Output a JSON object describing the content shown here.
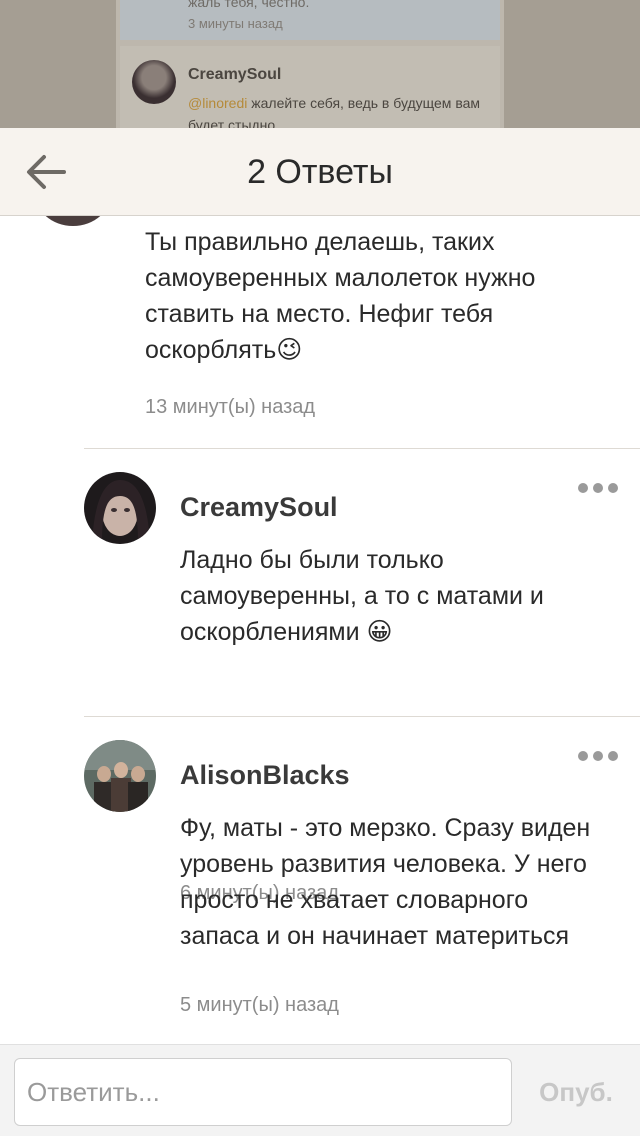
{
  "background": {
    "prev_text": "жаль тебя, честно.",
    "prev_time": "3 минуты назад",
    "comment": {
      "author": "CreamySoul",
      "mention": "@linoredi",
      "text": " жалейте себя, ведь в будущем вам будет стыдно"
    }
  },
  "header": {
    "title": "2 Ответы"
  },
  "thread": {
    "first": {
      "text": "Ты правильно делаешь, таких самоуверенных малолеток нужно ставить на место. Нефиг тебя оскорблять",
      "emoji": "😉",
      "time": "13 минут(ы) назад"
    },
    "replies": [
      {
        "author": "CreamySoul",
        "text": "Ладно бы были только самоуверенны, а то с матами и оскорблениями",
        "emoji": "😀",
        "time": "6 минут(ы) назад"
      },
      {
        "author": "AlisonBlacks",
        "text": "Фу, маты - это мерзко. Сразу виден уровень развития человека. У него просто не хватает словарного запаса и он начинает материться",
        "time": "5 минут(ы) назад"
      }
    ]
  },
  "footer": {
    "placeholder": "Ответить...",
    "publish_label": "Опуб."
  },
  "icons": {
    "back": "arrow-left-icon",
    "more": "more-dots-icon"
  },
  "colors": {
    "header_bg": "#f7f3ee",
    "mention": "#b58a3a",
    "muted": "#8c8c8c"
  }
}
